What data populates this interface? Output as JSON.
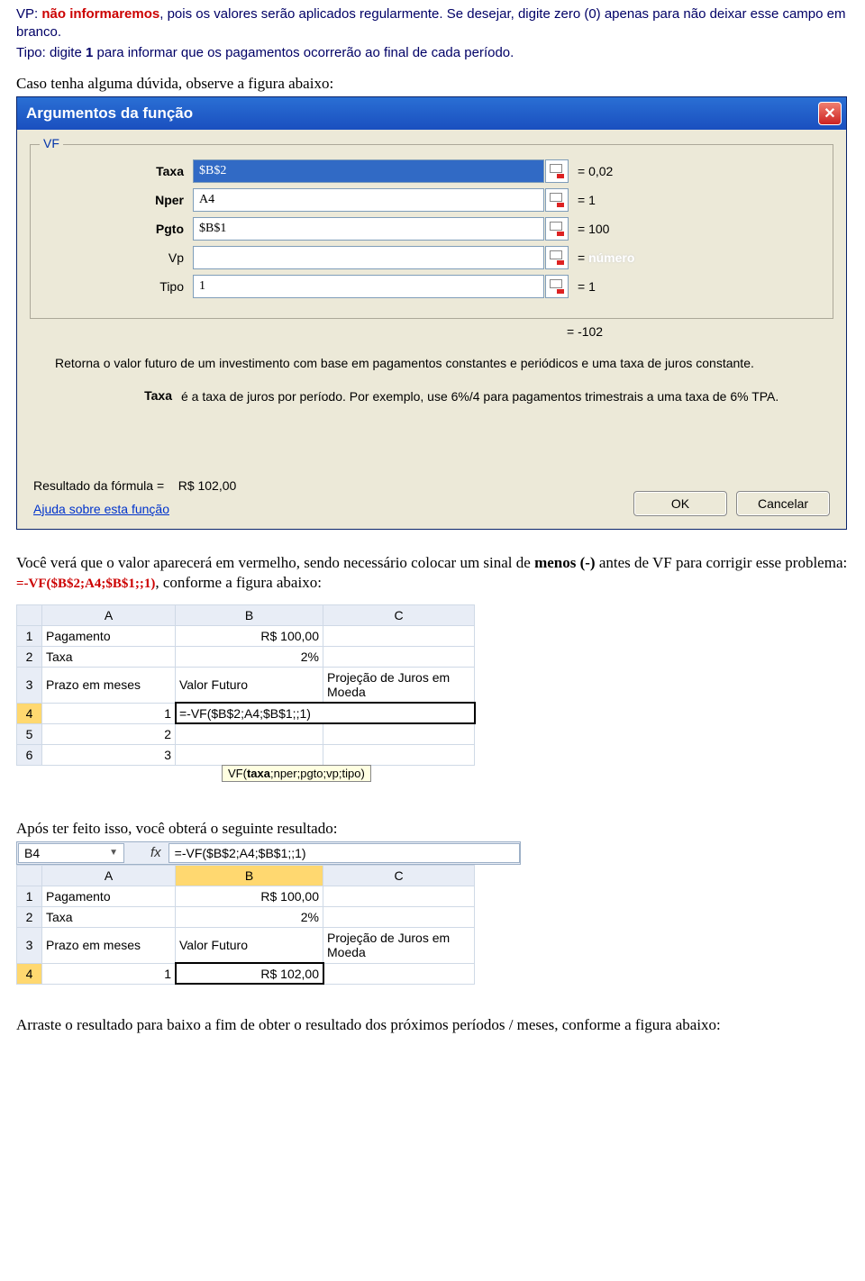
{
  "intro": {
    "prefix": "VP: ",
    "red": "não informaremos",
    "rest1": ", pois os valores serão aplicados regularmente. Se desejar, digite zero (0) apenas para não deixar esse campo em branco.",
    "line2a": "Tipo: digite ",
    "line2b": "1",
    "line2c": " para informar que os pagamentos ocorrerão ao final de cada período."
  },
  "figure_note": "Caso tenha alguma dúvida, observe a figura abaixo:",
  "dialog": {
    "title": "Argumentos da função",
    "func": "VF",
    "rows": {
      "taxa": {
        "lbl": "Taxa",
        "val": "$B$2",
        "eq": "= 0,02"
      },
      "nper": {
        "lbl": "Nper",
        "val": "A4",
        "eq": "= 1"
      },
      "pgto": {
        "lbl": "Pgto",
        "val": "$B$1",
        "eq": "= 100"
      },
      "vp": {
        "lbl": "Vp",
        "val": "",
        "eq": "=",
        "ph": "número"
      },
      "tipo": {
        "lbl": "Tipo",
        "val": "1",
        "eq": "= 1"
      }
    },
    "result_eq": "= -102",
    "desc": "Retorna o valor futuro de um investimento com base em pagamentos constantes e periódicos e uma taxa de juros constante.",
    "param_lbl": "Taxa",
    "param_txt": "é a taxa de juros por período. Por exemplo, use 6%/4 para pagamentos trimestrais a uma taxa de 6% TPA.",
    "result_line_lbl": "Resultado da fórmula =",
    "result_line_val": "R$ 102,00",
    "help": "Ajuda sobre esta função",
    "ok": "OK",
    "cancel": "Cancelar"
  },
  "mid": {
    "t1": "Você verá que o valor aparecerá em vermelho, sendo necessário colocar um sinal de ",
    "t2": "menos (-)",
    "t3": " antes de VF para corrigir esse problema: ",
    "formula": "=-VF($B$2;A4;$B$1;;1)",
    "t4": ", conforme a figura abaixo:"
  },
  "table1": {
    "cols": {
      "a": "A",
      "b": "B",
      "c": "C"
    },
    "r1": {
      "a": "Pagamento",
      "b": "R$ 100,00",
      "c": ""
    },
    "r2": {
      "a": "Taxa",
      "b": "2%",
      "c": ""
    },
    "r3": {
      "a": "Prazo em meses",
      "b": "Valor Futuro",
      "c": "Projeção de Juros em Moeda"
    },
    "r4": {
      "a": "1",
      "b": "=-VF($B$2;A4;$B$1;;1)",
      "c": ""
    },
    "r5": {
      "a": "2"
    },
    "r6": {
      "a": "3"
    },
    "tooltip": "VF(taxa;nper;pgto;vp;tipo)"
  },
  "after_text": "Após ter feito isso, você obterá o seguinte resultado:",
  "fbar": {
    "name": "B4",
    "fx": "fx",
    "formula": "=-VF($B$2;A4;$B$1;;1)"
  },
  "table2": {
    "cols": {
      "a": "A",
      "b": "B",
      "c": "C"
    },
    "r1": {
      "a": "Pagamento",
      "b": "R$ 100,00",
      "c": ""
    },
    "r2": {
      "a": "Taxa",
      "b": "2%",
      "c": ""
    },
    "r3": {
      "a": "Prazo em meses",
      "b": "Valor Futuro",
      "c": "Projeção de Juros em Moeda"
    },
    "r4": {
      "a": "1",
      "b": "R$ 102,00",
      "c": ""
    }
  },
  "footer_text": "Arraste o resultado para baixo a fim de obter o resultado dos próximos períodos / meses, conforme a figura abaixo:"
}
